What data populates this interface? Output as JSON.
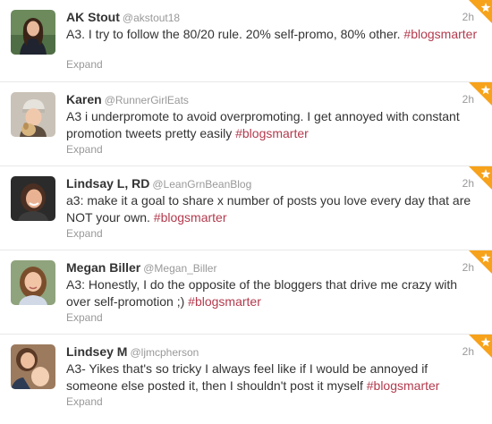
{
  "tweets": [
    {
      "name": "AK Stout",
      "handle": "@akstout18",
      "time": "2h",
      "text": "A3. I try to follow the 80/20 rule. 20% self-promo, 80% other.",
      "hashtag": "#blogsmarter",
      "expand": "Expand",
      "avatar_icon": "woman-dark-hair-avatar"
    },
    {
      "name": "Karen",
      "handle": "@RunnerGirlEats",
      "time": "2h",
      "text": "A3 i underpromote to avoid overpromoting. I get annoyed with constant promotion tweets pretty easily",
      "hashtag": "#blogsmarter",
      "expand": "Expand",
      "avatar_icon": "woman-beanie-dog-avatar"
    },
    {
      "name": "Lindsay L, RD",
      "handle": "@LeanGrnBeanBlog",
      "time": "2h",
      "text": "a3: make it a goal to share x number of posts you love every day that are NOT your own.",
      "hashtag": "#blogsmarter",
      "expand": "Expand",
      "avatar_icon": "woman-smiling-avatar"
    },
    {
      "name": "Megan Biller",
      "handle": "@Megan_Biller",
      "time": "2h",
      "text": "A3: Honestly, I do the opposite of the bloggers that drive me crazy with over self-promotion ;)",
      "hashtag": "#blogsmarter",
      "expand": "Expand",
      "avatar_icon": "woman-brown-hair-avatar"
    },
    {
      "name": "Lindsey M",
      "handle": "@ljmcpherson",
      "time": "2h",
      "text": "A3- Yikes that's so tricky I always feel like if I would be annoyed if someone else posted it, then I shouldn't post it myself",
      "hashtag": "#blogsmarter",
      "expand": "Expand",
      "avatar_icon": "woman-and-child-avatar"
    }
  ],
  "colors": {
    "hashtag": "#b33a4d",
    "favorite_corner": "#f7a21b",
    "meta_text": "#999999"
  }
}
